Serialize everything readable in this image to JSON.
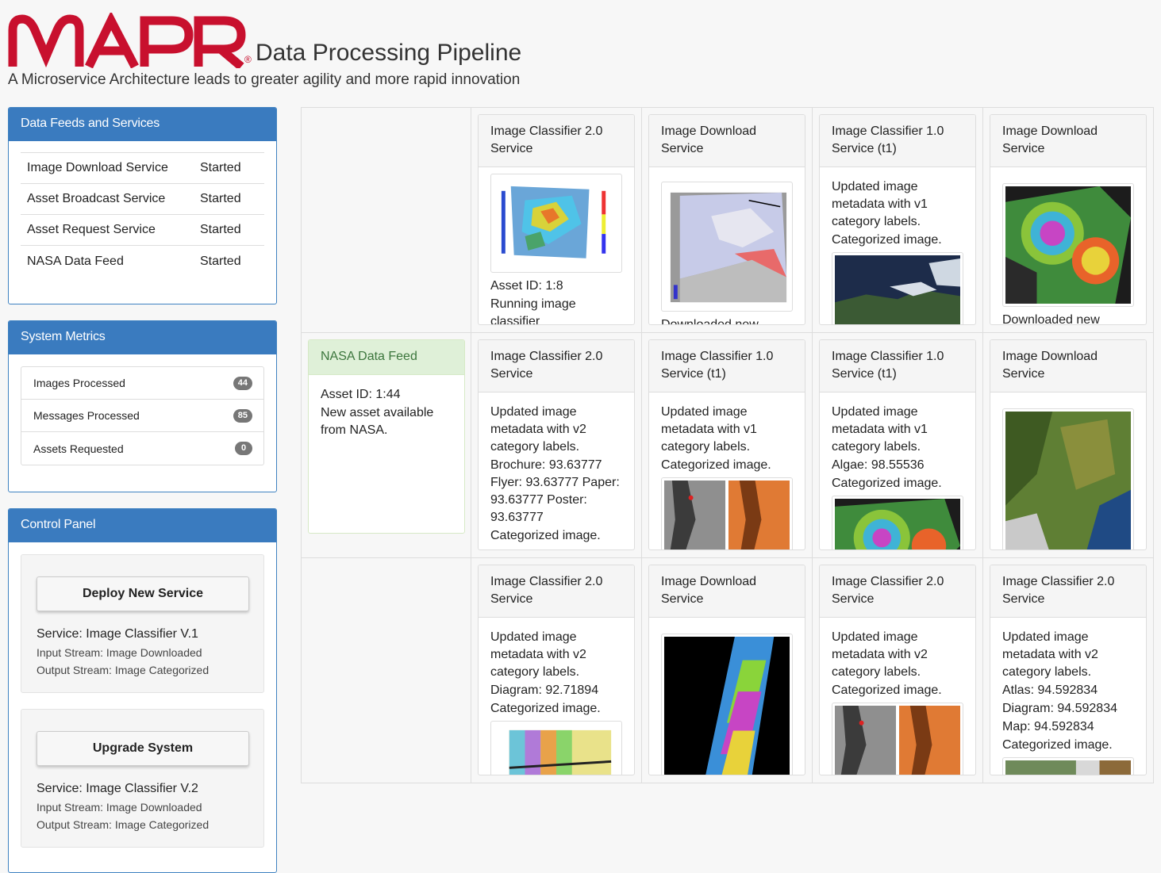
{
  "header": {
    "logo_text": "MAPR",
    "logo_reg": "®",
    "title": "Data Processing Pipeline",
    "subtitle": "A Microservice Architecture leads to greater agility and more rapid innovation"
  },
  "feeds_panel": {
    "title": "Data Feeds and Services",
    "rows": [
      {
        "name": "Image Download Service",
        "status": "Started"
      },
      {
        "name": "Asset Broadcast Service",
        "status": "Started"
      },
      {
        "name": "Asset Request Service",
        "status": "Started"
      },
      {
        "name": "NASA Data Feed",
        "status": "Started"
      }
    ]
  },
  "metrics_panel": {
    "title": "System Metrics",
    "rows": [
      {
        "label": "Images Processed",
        "count": "44"
      },
      {
        "label": "Messages Processed",
        "count": "85"
      },
      {
        "label": "Assets Requested",
        "count": "0"
      }
    ]
  },
  "control_panel": {
    "title": "Control Panel",
    "wells": [
      {
        "button": "Deploy New Service",
        "service": "Service: Image Classifier V.1",
        "input": "Input Stream: Image Downloaded",
        "output": "Output Stream: Image Categorized"
      },
      {
        "button": "Upgrade System",
        "service": "Service: Image Classifier V.2",
        "input": "Input Stream: Image Downloaded",
        "output": "Output Stream: Image Categorized"
      }
    ]
  },
  "grid": {
    "row1": [
      {
        "title": "Image Classifier 2.0 Service",
        "lines_after": [
          "Asset ID: 1:8",
          "Running image classifier"
        ],
        "image": "heatmap-map"
      },
      {
        "title": "Image Download Service",
        "lines_after": [
          "Downloaded new"
        ],
        "image": "radar-map"
      },
      {
        "title": "Image Classifier 1.0 Service (t1)",
        "lines_before": [
          "Updated image metadata with v1 category labels.",
          "Categorized image."
        ],
        "image": "satellite-coast"
      },
      {
        "title": "Image Download Service",
        "lines_after": [
          "Downloaded new"
        ],
        "image": "interferogram"
      }
    ],
    "row2": [
      {
        "title": "NASA Data Feed",
        "lines_before": [
          "Asset ID: 1:44",
          "New asset available from NASA."
        ]
      },
      {
        "title": "Image Classifier 2.0 Service",
        "lines_before": [
          "Updated image metadata with v2 category labels.",
          "Brochure: 93.63777 Flyer: 93.63777 Paper: 93.63777 Poster: 93.63777",
          "Categorized image."
        ]
      },
      {
        "title": "Image Classifier 1.0 Service (t1)",
        "lines_before": [
          "Updated image metadata with v1 category labels.",
          "Categorized image."
        ],
        "image": "radar-pair"
      },
      {
        "title": "Image Classifier 1.0 Service (t1)",
        "lines_before": [
          "Updated image metadata with v1 category labels.",
          "Algae: 98.55536",
          "Categorized image."
        ],
        "image": "interferogram"
      },
      {
        "title": "Image Download Service",
        "image": "terrain"
      }
    ],
    "row3": [
      {
        "title": "Image Classifier 2.0 Service",
        "lines_before": [
          "Updated image metadata with v2 category labels.",
          "Diagram: 92.71894",
          "Categorized image."
        ],
        "image": "fringe-map"
      },
      {
        "title": "Image Download Service",
        "image": "rainbow-strip"
      },
      {
        "title": "Image Classifier 2.0 Service",
        "lines_before": [
          "Updated image metadata with v2 category labels.",
          "Categorized image."
        ],
        "image": "radar-pair"
      },
      {
        "title": "Image Classifier 2.0 Service",
        "lines_before": [
          "Updated image metadata with v2 category labels.",
          "Atlas: 94.592834",
          "Diagram: 94.592834",
          "Map: 94.592834",
          "Categorized image."
        ],
        "image": "aerial-strip"
      }
    ]
  },
  "colors": {
    "brand_red": "#c8102e",
    "panel_blue": "#3a7bbf",
    "nasa_green": "#dff0d8"
  }
}
